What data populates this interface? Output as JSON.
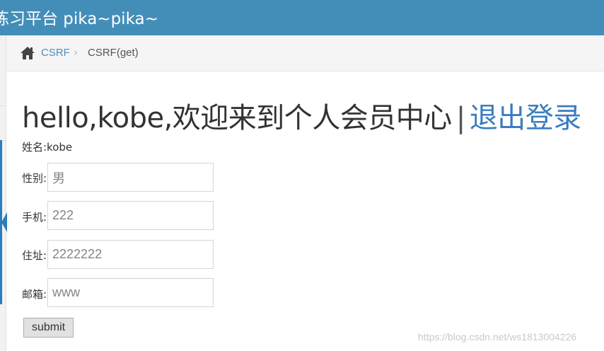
{
  "header": {
    "brand": "练习平台 pika~pika~"
  },
  "breadcrumb": {
    "link": "CSRF",
    "separator": "›",
    "current": "CSRF(get)"
  },
  "main": {
    "title_greeting": "hello,kobe,欢迎来到个人会员中心",
    "title_separator": "|",
    "logout_label": "退出登录",
    "name_row": "姓名:kobe",
    "fields": [
      {
        "label": "性别:",
        "value": "男"
      },
      {
        "label": "手机:",
        "value": "222"
      },
      {
        "label": "住址:",
        "value": "2222222"
      },
      {
        "label": "邮箱:",
        "value": "www"
      }
    ],
    "submit_label": "submit"
  },
  "watermark": "https://blog.csdn.net/ws1813004226",
  "colors": {
    "header_bg": "#438eb9",
    "link": "#4c8fbd",
    "logout": "#3a7dbf",
    "accent": "#2b7dbc"
  },
  "icons": {
    "breadcrumb_home": "home-icon"
  }
}
